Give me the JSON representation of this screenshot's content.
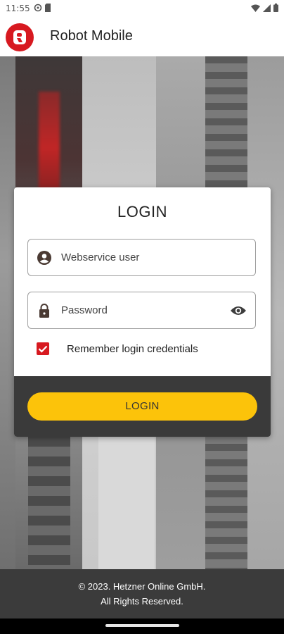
{
  "status_bar": {
    "time": "11:55",
    "left_icons": [
      "settings-icon",
      "sim-card-icon"
    ],
    "right_icons": [
      "wifi-icon",
      "signal-icon",
      "battery-icon"
    ]
  },
  "app_bar": {
    "logo_letter": "R",
    "title": "Robot Mobile"
  },
  "login_card": {
    "title": "LOGIN",
    "user_field": {
      "placeholder": "Webservice user",
      "icon": "person-icon"
    },
    "password_field": {
      "placeholder": "Password",
      "icon": "lock-icon",
      "toggle_icon": "eye-icon"
    },
    "remember": {
      "label": "Remember login credentials",
      "checked": true
    },
    "login_button": "LOGIN"
  },
  "footer": {
    "line1": "© 2023. Hetzner Online GmbH.",
    "line2": "All Rights Reserved."
  },
  "colors": {
    "brand_red": "#d71920",
    "button_yellow": "#fcc30a",
    "footer_bg": "#3b3b3b"
  }
}
